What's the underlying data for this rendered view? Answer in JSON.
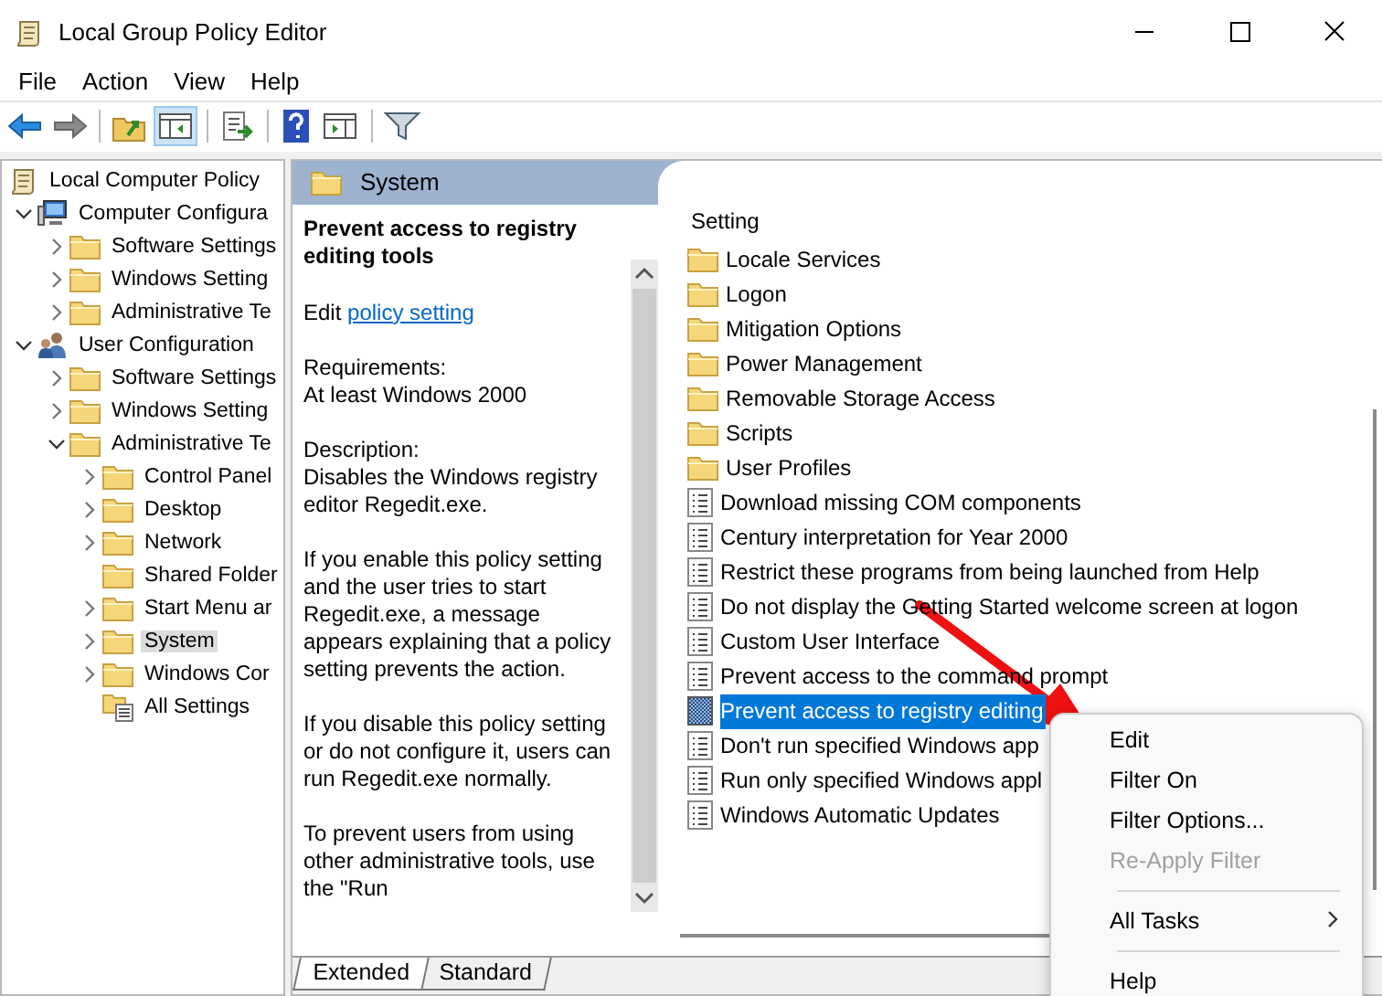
{
  "window": {
    "title": "Local Group Policy Editor"
  },
  "menu_bar": [
    "File",
    "Action",
    "View",
    "Help"
  ],
  "tree": [
    {
      "label": "Local Computer Policy",
      "kind": "policy",
      "selected": false,
      "children": [
        {
          "label": "Computer Configura",
          "kind": "computer",
          "expanded": true,
          "selected": false,
          "children": [
            {
              "label": "Software Settings",
              "kind": "folder",
              "expanded": false,
              "selected": false
            },
            {
              "label": "Windows Setting",
              "kind": "folder",
              "expanded": false,
              "selected": false
            },
            {
              "label": "Administrative Te",
              "kind": "folder",
              "expanded": false,
              "selected": false
            }
          ]
        },
        {
          "label": "User Configuration",
          "kind": "user",
          "expanded": true,
          "selected": false,
          "children": [
            {
              "label": "Software Settings",
              "kind": "folder",
              "expanded": false,
              "selected": false
            },
            {
              "label": "Windows Setting",
              "kind": "folder",
              "expanded": false,
              "selected": false
            },
            {
              "label": "Administrative Te",
              "kind": "folder",
              "expanded": true,
              "selected": false,
              "children": [
                {
                  "label": "Control Panel",
                  "kind": "folder",
                  "expanded": false,
                  "selected": false
                },
                {
                  "label": "Desktop",
                  "kind": "folder",
                  "expanded": false,
                  "selected": false
                },
                {
                  "label": "Network",
                  "kind": "folder",
                  "expanded": false,
                  "selected": false
                },
                {
                  "label": "Shared Folder",
                  "kind": "folder",
                  "selected": false
                },
                {
                  "label": "Start Menu ar",
                  "kind": "folder",
                  "expanded": false,
                  "selected": false
                },
                {
                  "label": "System",
                  "kind": "folder",
                  "expanded": false,
                  "selected": true
                },
                {
                  "label": "Windows Cor",
                  "kind": "folder",
                  "expanded": false,
                  "selected": false
                },
                {
                  "label": "All Settings",
                  "kind": "all-settings",
                  "selected": false
                }
              ]
            }
          ]
        }
      ]
    }
  ],
  "details": {
    "header": "System",
    "title": "Prevent access to registry editing tools",
    "edit_prefix": "Edit",
    "edit_link": "policy setting",
    "paragraphs": [
      "Requirements:\nAt least Windows 2000",
      "Description:\nDisables the Windows registry editor Regedit.exe.",
      "If you enable this policy setting and the user tries to start Regedit.exe, a message appears explaining that a policy setting prevents the action.",
      "If you disable this policy setting or do not configure it, users can run Regedit.exe normally.",
      "To prevent users from using other administrative tools, use the \"Run"
    ]
  },
  "settings": {
    "column": "Setting",
    "items": [
      {
        "label": "Locale Services",
        "kind": "folder",
        "selected": false
      },
      {
        "label": "Logon",
        "kind": "folder",
        "selected": false
      },
      {
        "label": "Mitigation Options",
        "kind": "folder",
        "selected": false
      },
      {
        "label": "Power Management",
        "kind": "folder",
        "selected": false
      },
      {
        "label": "Removable Storage Access",
        "kind": "folder",
        "selected": false
      },
      {
        "label": "Scripts",
        "kind": "folder",
        "selected": false
      },
      {
        "label": "User Profiles",
        "kind": "folder",
        "selected": false
      },
      {
        "label": "Download missing COM components",
        "kind": "setting",
        "selected": false
      },
      {
        "label": "Century interpretation for Year 2000",
        "kind": "setting",
        "selected": false
      },
      {
        "label": "Restrict these programs from being launched from Help",
        "kind": "setting",
        "selected": false
      },
      {
        "label": "Do not display the Getting Started welcome screen at logon",
        "kind": "setting",
        "selected": false
      },
      {
        "label": "Custom User Interface",
        "kind": "setting",
        "selected": false
      },
      {
        "label": "Prevent access to the command prompt",
        "kind": "setting",
        "selected": false
      },
      {
        "label": "Prevent access to registry editing",
        "kind": "setting",
        "selected": true
      },
      {
        "label": "Don't run specified Windows app",
        "kind": "setting",
        "selected": false
      },
      {
        "label": "Run only specified Windows appl",
        "kind": "setting",
        "selected": false
      },
      {
        "label": "Windows Automatic Updates",
        "kind": "setting",
        "selected": false
      }
    ]
  },
  "view_tabs": [
    {
      "label": "Extended",
      "selected": true
    },
    {
      "label": "Standard",
      "selected": false
    }
  ],
  "context_menu": [
    {
      "kind": "item",
      "label": "Edit",
      "disabled": false
    },
    {
      "kind": "item",
      "label": "Filter On",
      "disabled": false
    },
    {
      "kind": "item",
      "label": "Filter Options...",
      "disabled": false
    },
    {
      "kind": "item",
      "label": "Re-Apply Filter",
      "disabled": true
    },
    {
      "kind": "separator"
    },
    {
      "kind": "submenu",
      "label": "All Tasks",
      "disabled": false
    },
    {
      "kind": "separator"
    },
    {
      "kind": "item",
      "label": "Help",
      "disabled": false
    }
  ]
}
